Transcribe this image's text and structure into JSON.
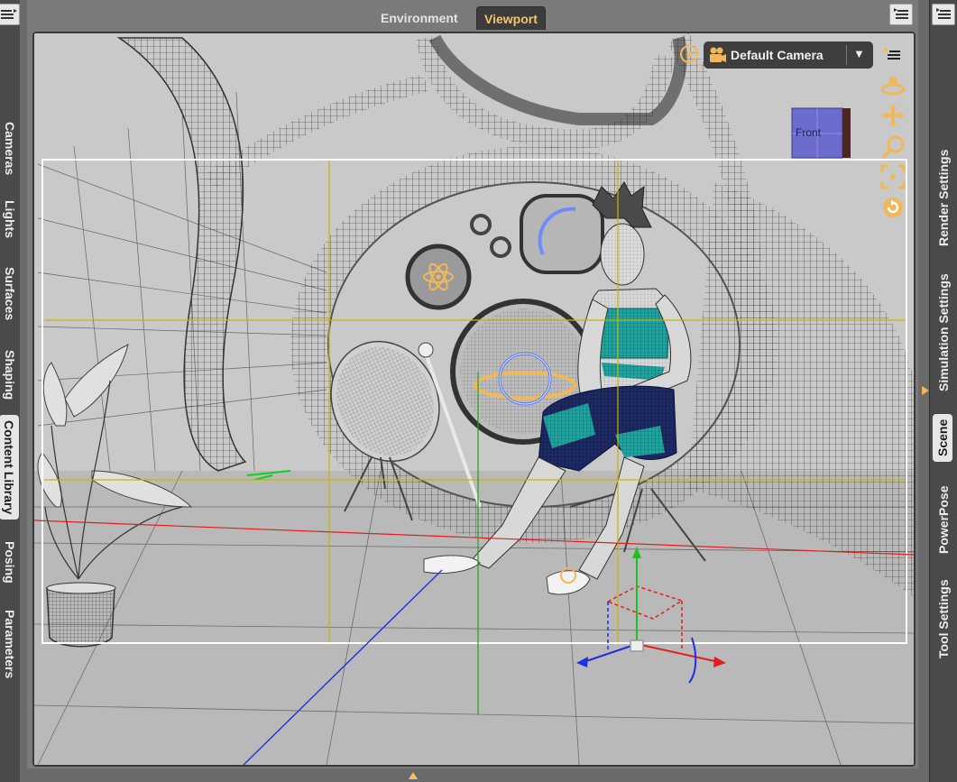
{
  "left_tabs": [
    "Cameras",
    "Lights",
    "Surfaces",
    "Shaping",
    "Content Library",
    "Posing",
    "Parameters"
  ],
  "left_active": "Content Library",
  "right_tabs": [
    "Render Settings",
    "Simulation Settings",
    "Scene",
    "PowerPose",
    "Tool Settings"
  ],
  "right_active": "Scene",
  "main_tabs": {
    "environment": "Environment",
    "viewport": "Viewport"
  },
  "active_tab": "Viewport",
  "camera": {
    "label": "Default Camera",
    "dropdown_arrow": "▼"
  },
  "view_cube": {
    "face_label": "Front"
  },
  "nav_icons": [
    "orbit-icon",
    "pan-icon",
    "zoom-icon",
    "frame-icon",
    "reset-view-icon"
  ],
  "colors": {
    "accent": "#f0b85a",
    "guide": "#c8b400",
    "x_axis": "#e02020",
    "y_axis": "#20c020",
    "z_axis": "#2030e0",
    "outfit": "#1aa7a3"
  }
}
